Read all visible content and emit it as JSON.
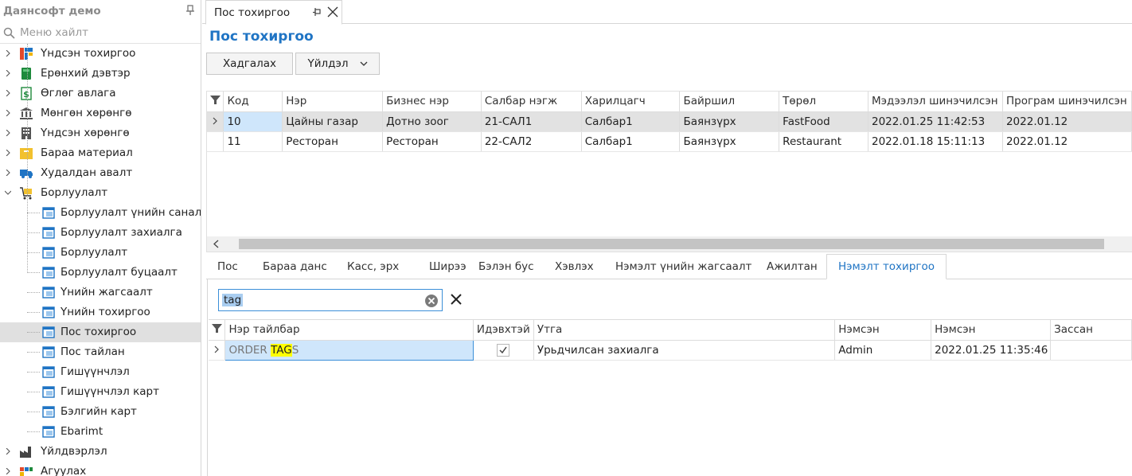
{
  "sidebar": {
    "title": "Даянсофт демо",
    "search_placeholder": "Меню хайлт",
    "items": [
      {
        "label": "Үндсэн тохиргоо",
        "icon": "settings-grid-icon"
      },
      {
        "label": "Ерөнхий дэвтэр",
        "icon": "ledger-book-icon"
      },
      {
        "label": "Өглөг авлага",
        "icon": "dollar-doc-icon"
      },
      {
        "label": "Мөнгөн хөрөнгө",
        "icon": "bank-icon"
      },
      {
        "label": "Үндсэн хөрөнгө",
        "icon": "building-icon"
      },
      {
        "label": "Бараа материал",
        "icon": "box-icon"
      },
      {
        "label": "Худалдан авалт",
        "icon": "truck-icon"
      },
      {
        "label": "Борлуулалт",
        "icon": "cart-icon"
      }
    ],
    "sales_children": [
      "Борлуулалт үнийн санал",
      "Борлуулалт захиалга",
      "Борлуулалт",
      "Борлуулалт буцаалт",
      "Үнийн жагсаалт",
      "Үнийн тохиргоо",
      "Пос тохиргоо",
      "Пос тайлан",
      "Гишүүнчлэл",
      "Гишүүнчлэл карт",
      "Бэлгийн карт",
      "Ebarimt"
    ],
    "after_items": [
      {
        "label": "Үйлдвэрлэл",
        "icon": "factory-icon"
      },
      {
        "label": "Агуулах",
        "icon": "warehouse-icon"
      }
    ],
    "selected": "Пос тохиргоо"
  },
  "doc_tab": {
    "label": "Пос тохиргоо"
  },
  "page": {
    "title": "Пос тохиргоо"
  },
  "toolbar": {
    "save_label": "Хадгалах",
    "action_label": "Үйлдэл"
  },
  "main_grid": {
    "columns": [
      "Код",
      "Нэр",
      "Бизнес нэр",
      "Салбар нэгж",
      "Харилцагч",
      "Байршил",
      "Төрөл",
      "Мэдээлэл шинэчилсэн",
      "Програм шинэчилсэн"
    ],
    "rows": [
      [
        "10",
        "Цайны газар",
        "Дотно зоог",
        "21-САЛ1",
        "Салбар1",
        "Баянзүрх",
        "FastFood",
        "2022.01.25 11:42:53",
        "2022.01.12"
      ],
      [
        "11",
        "Ресторан",
        "Ресторан",
        "22-САЛ2",
        "Салбар1",
        "Баянзүрх",
        "Restaurant",
        "2022.01.18 15:11:13",
        "2022.01.12"
      ]
    ]
  },
  "inner_tabs": [
    "Пос",
    "Бараа данс",
    "Касс, эрх",
    "Ширээ",
    "Бэлэн бус",
    "Хэвлэх",
    "Нэмэлт үнийн жагсаалт",
    "Ажилтан",
    "Нэмэлт тохиргоо"
  ],
  "active_inner_tab": "Нэмэлт тохиргоо",
  "filter": {
    "value": "tag"
  },
  "detail_grid": {
    "columns": [
      "Нэр тайлбар",
      "Идэвхтэй",
      "Утга",
      "Нэмсэн",
      "Нэмсэн",
      "Зассан"
    ],
    "row": {
      "name_before": "ORDER ",
      "name_match": "TAG",
      "name_after": "S",
      "active": true,
      "value": "Урьдчилсан захиалга",
      "added_by": "Admin",
      "added_at": "2022.01.25 11:35:46",
      "edited": ""
    }
  },
  "colors": {
    "accent": "#1f74c4",
    "selected_row": "#e2e2e2",
    "current_cell": "#cfe6fb",
    "highlight": "#ffff00"
  }
}
